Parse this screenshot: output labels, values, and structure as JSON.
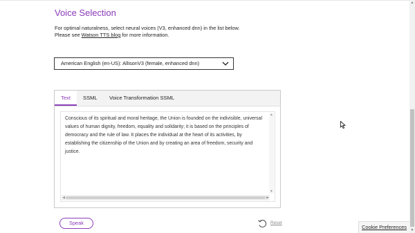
{
  "header": {
    "title": "Voice Selection",
    "intro_line1": "For optimal naturalness, select neural voices (V3, enhanced dnn) in the list below.",
    "intro_line2_prefix": "Please see ",
    "intro_link": "Watson TTS blog",
    "intro_line2_suffix": " for more information."
  },
  "voice_select": {
    "selected": "American English (en-US): AllisonV3 (female, enhanced dnn)",
    "icon": "chevron-down-icon"
  },
  "tabs": [
    {
      "label": "Text",
      "active": true
    },
    {
      "label": "SSML",
      "active": false
    },
    {
      "label": "Voice Transformation SSML",
      "active": false
    }
  ],
  "text_input": {
    "value": "Conscious of its spiritual and moral heritage, the Union is founded on the indivisible, universal values of human dignity, freedom, equality and solidarity; it is based on the principles of democracy and the rule of law. It places the individual at the heart of its activities, by establishing the citizenship of the Union and by creating an area of freedom, security and justice."
  },
  "actions": {
    "speak_label": "Speak",
    "reset_label": "Reset",
    "reset_icon": "reset-icon"
  },
  "footer": {
    "cookie_label": "Cookie Preferences"
  },
  "colors": {
    "accent": "#8a3ab9",
    "border": "#333333",
    "muted_text": "#888888"
  }
}
